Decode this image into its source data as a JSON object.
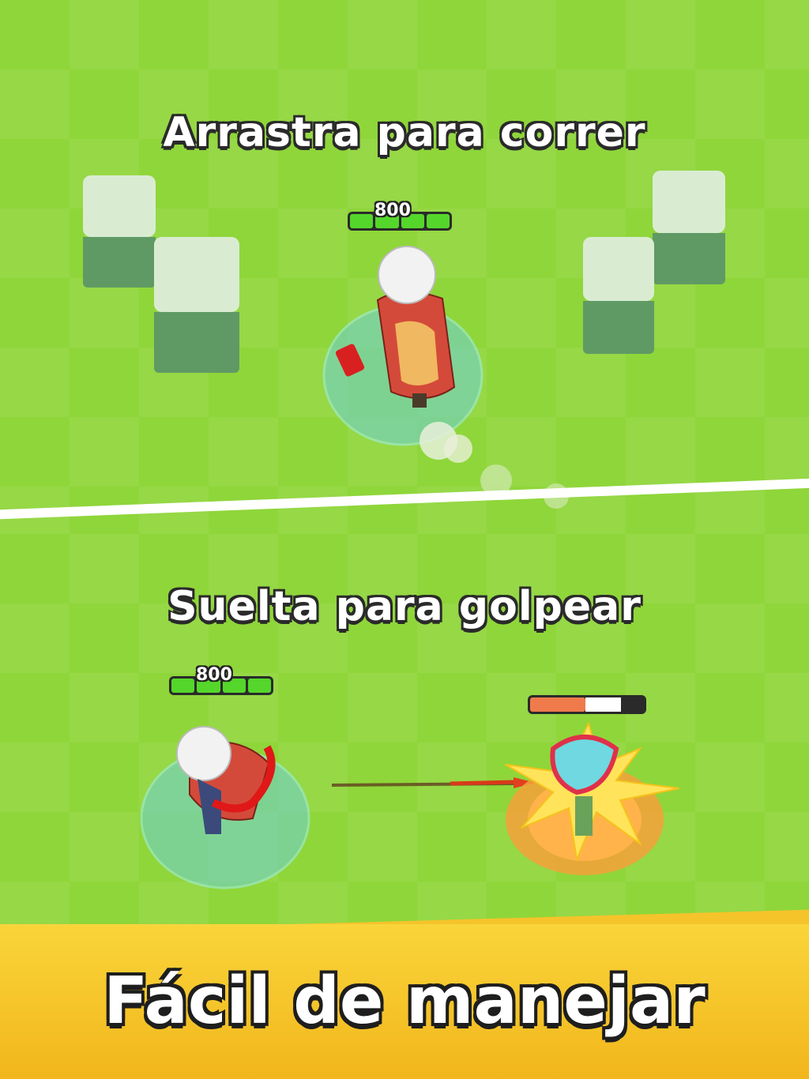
{
  "top_caption": "Arrastra para correr",
  "bottom_caption": "Suelta para golpear",
  "banner_title": "Fácil de manejar",
  "hero_top": {
    "hp": "800"
  },
  "hero_bottom": {
    "hp": "800"
  },
  "enemy": {
    "health_fraction": 0.5
  },
  "colors": {
    "grass": "#8fd63a",
    "banner": "#f5c42a",
    "hp_green": "#55d62b",
    "enemy_red": "#ef7b4d"
  }
}
